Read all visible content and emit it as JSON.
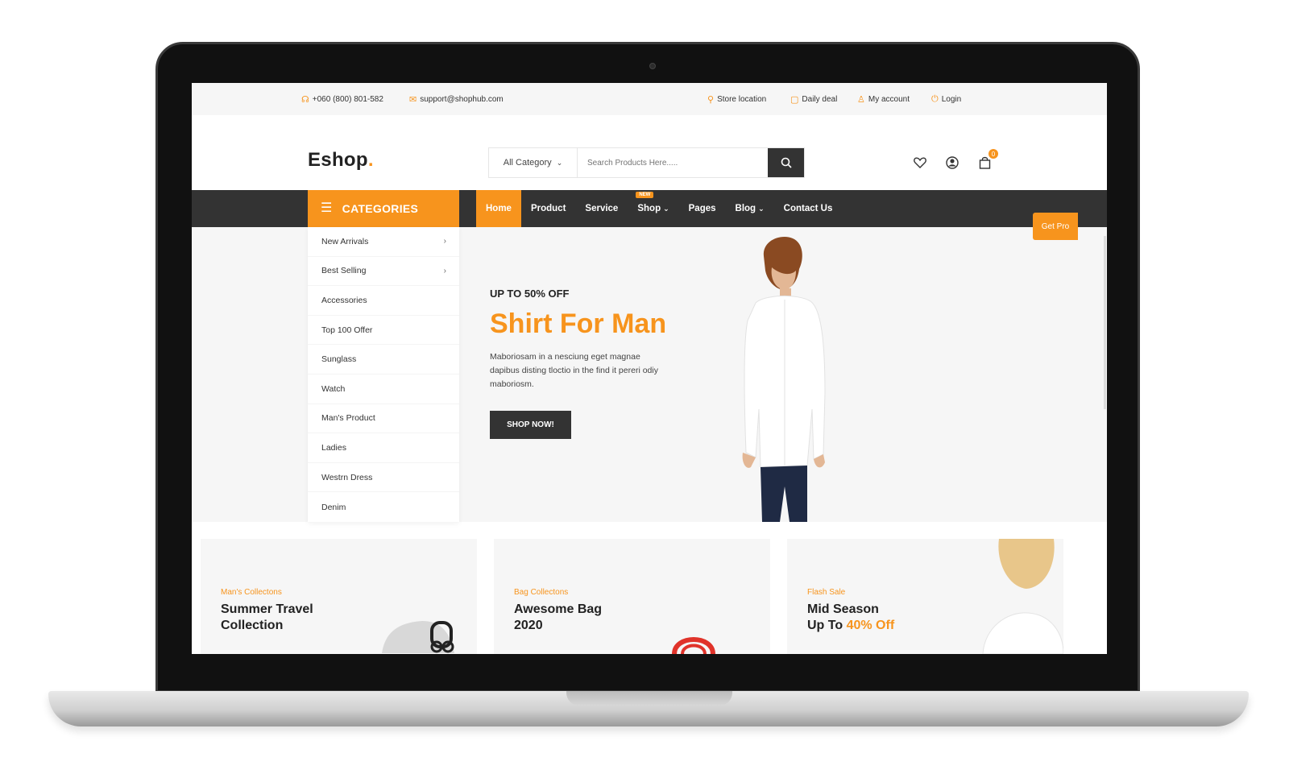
{
  "topbar": {
    "phone": "+060 (800) 801-582",
    "email": "support@shophub.com",
    "store_location": "Store location",
    "daily_deal": "Daily deal",
    "my_account": "My account",
    "login": "Login"
  },
  "brand": {
    "name": "Eshop",
    "dot": "."
  },
  "search": {
    "category": "All Category",
    "placeholder": "Search Products Here....."
  },
  "cart": {
    "count": "0"
  },
  "nav": {
    "categories_label": "CATEGORIES",
    "links": [
      {
        "label": "Home"
      },
      {
        "label": "Product"
      },
      {
        "label": "Service"
      },
      {
        "label": "Shop",
        "badge": "NEW"
      },
      {
        "label": "Pages"
      },
      {
        "label": "Blog"
      },
      {
        "label": "Contact Us"
      }
    ],
    "get_pro": "Get Pro"
  },
  "categories": [
    {
      "label": "New Arrivals",
      "arrow": "›"
    },
    {
      "label": "Best Selling",
      "arrow": "›"
    },
    {
      "label": "Accessories"
    },
    {
      "label": "Top 100 Offer"
    },
    {
      "label": "Sunglass"
    },
    {
      "label": "Watch"
    },
    {
      "label": "Man's Product"
    },
    {
      "label": "Ladies"
    },
    {
      "label": "Westrn Dress"
    },
    {
      "label": "Denim"
    }
  ],
  "hero": {
    "subtitle": "UP TO 50% OFF",
    "title": "Shirt For Man",
    "description": "Maboriosam in a nesciung eget magnae dapibus disting tloctio in the find it pereri odiy maboriosm.",
    "button": "SHOP NOW!"
  },
  "banners": [
    {
      "tag": "Man's Collectons",
      "title_line1": "Summer Travel",
      "title_line2": "Collection"
    },
    {
      "tag": "Bag Collectons",
      "title_line1": "Awesome Bag",
      "title_line2": "2020"
    },
    {
      "tag": "Flash Sale",
      "title_line1": "Mid Season",
      "title_line2_pre": "Up To ",
      "title_line2_hl": "40% Off"
    }
  ],
  "colors": {
    "accent": "#f7941d",
    "dark": "#333333",
    "light_bg": "#f6f6f6"
  }
}
